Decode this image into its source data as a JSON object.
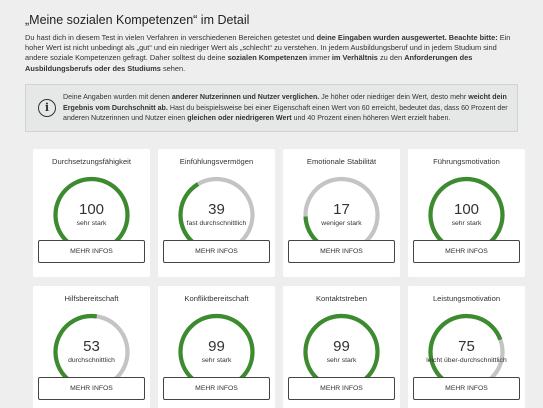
{
  "page": {
    "title": "„Meine sozialen Kompetenzen“ im Detail",
    "intro": [
      {
        "t": "Du hast dich in diesem Test in vielen Verfahren in verschiedenen Bereichen getestet und ",
        "b": false
      },
      {
        "t": "deine Eingaben wurden ausgewertet. Beachte bitte:",
        "b": true
      },
      {
        "t": " Ein hoher Wert ist nicht unbedingt als „gut“ und ein niedriger Wert als „schlecht“ zu verstehen. In jedem Ausbildungsberuf und in jedem Studium sind andere soziale Kompetenzen gefragt. Daher solltest du deine ",
        "b": false
      },
      {
        "t": "sozialen Kompetenzen",
        "b": true
      },
      {
        "t": " immer ",
        "b": false
      },
      {
        "t": "im Verhältnis",
        "b": true
      },
      {
        "t": " zu den ",
        "b": false
      },
      {
        "t": "Anforderungen des Ausbildungsberufs oder des Studiums",
        "b": true
      },
      {
        "t": " sehen.",
        "b": false
      }
    ],
    "info_icon": "i",
    "info": [
      {
        "t": "Deine Angaben wurden mit denen ",
        "b": false
      },
      {
        "t": "anderer Nutzerinnen und Nutzer verglichen.",
        "b": true
      },
      {
        "t": " Je höher oder niedriger dein Wert, desto mehr ",
        "b": false
      },
      {
        "t": "weicht dein Ergebnis vom Durchschnitt ab.",
        "b": true
      },
      {
        "t": " Hast du beispielsweise bei einer Eigenschaft einen Wert von 60 erreicht, bedeutet das, dass 60 Prozent der anderen Nutzerinnen und Nutzer einen ",
        "b": false
      },
      {
        "t": "gleichen oder niedrigeren Wert",
        "b": true
      },
      {
        "t": " und 40 Prozent einen höheren Wert erzielt haben.",
        "b": false
      }
    ]
  },
  "colors": {
    "track": "#c4c4c4",
    "fill": "#3d8b2f"
  },
  "cards": [
    {
      "title": "Durchsetzungsfähigkeit",
      "value": 100,
      "label": "sehr stark",
      "fill_fraction": 1.0,
      "button": "MEHR INFOS"
    },
    {
      "title": "Einfühlungsvermögen",
      "value": 39,
      "label": "fast durchschnittlich",
      "fill_fraction": 0.39,
      "button": "MEHR INFOS"
    },
    {
      "title": "Emotionale Stabilität",
      "value": 17,
      "label": "weniger stark",
      "fill_fraction": 0.17,
      "button": "MEHR INFOS"
    },
    {
      "title": "Führungsmotivation",
      "value": 100,
      "label": "sehr stark",
      "fill_fraction": 1.0,
      "button": "MEHR INFOS"
    },
    {
      "title": "Hilfsbereitschaft",
      "value": 53,
      "label": "durchschnittlich",
      "fill_fraction": 0.53,
      "button": "MEHR INFOS"
    },
    {
      "title": "Konfliktbereitschaft",
      "value": 99,
      "label": "sehr stark",
      "fill_fraction": 0.99,
      "button": "MEHR INFOS"
    },
    {
      "title": "Kontaktstreben",
      "value": 99,
      "label": "sehr stark",
      "fill_fraction": 0.99,
      "button": "MEHR INFOS"
    },
    {
      "title": "Leistungsmotivation",
      "value": 75,
      "label": "leicht über-durchschnittlich",
      "fill_fraction": 0.75,
      "button": "MEHR INFOS"
    }
  ]
}
